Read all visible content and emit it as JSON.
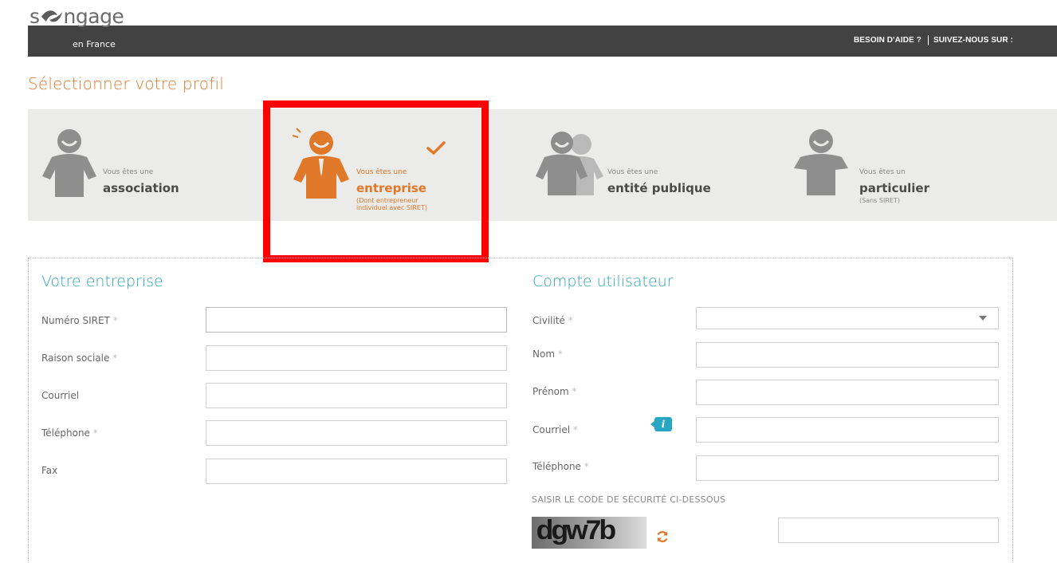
{
  "header": {
    "logo_text": "ngage",
    "logo_prefix": "s",
    "logo_subtitle": "en France",
    "help_link": "BESOIN D'AIDE ?",
    "follow_link": "SUIVEZ-NOUS SUR :"
  },
  "page_title": "Sélectionner votre profil",
  "profiles": [
    {
      "pre": "Vous êtes une",
      "main": "association",
      "note": ""
    },
    {
      "pre": "Vous êtes une",
      "main": "entreprise",
      "note_line1": "(Dont entrepreneur",
      "note_line2": "individuel avec SIRET)",
      "selected": true
    },
    {
      "pre": "Vous êtes une",
      "main": "entité publique",
      "note": ""
    },
    {
      "pre": "Vous êtes un",
      "main": "particulier",
      "note": "(Sans SIRET)"
    }
  ],
  "company_section": {
    "title": "Votre entreprise",
    "fields": [
      {
        "label": "Numéro SIRET",
        "required": "*",
        "value": ""
      },
      {
        "label": "Raison sociale",
        "required": "*",
        "value": ""
      },
      {
        "label": "Courriel",
        "required": "",
        "value": ""
      },
      {
        "label": "Téléphone",
        "required": "*",
        "value": ""
      },
      {
        "label": "Fax",
        "required": "",
        "value": ""
      }
    ]
  },
  "account_section": {
    "title": "Compte utilisateur",
    "fields": [
      {
        "label": "Civilité",
        "required": "*",
        "value": ""
      },
      {
        "label": "Nom",
        "required": "*",
        "value": ""
      },
      {
        "label": "Prénom",
        "required": "*",
        "value": ""
      },
      {
        "label": "Courriel",
        "required": "*",
        "value": ""
      },
      {
        "label": "Téléphone",
        "required": "*",
        "value": ""
      }
    ],
    "info_icon_glyph": "i",
    "captcha_label": "SAISIR LE CODE DE SÉCURITÉ CI-DESSOUS",
    "captcha_code": "dgw7b",
    "captcha_value": ""
  },
  "colors": {
    "accent_orange": "#e0782a",
    "accent_teal": "#2aa3b8",
    "header_bar": "#424242",
    "profile_band": "#ebebe9",
    "highlight": "#ff0000"
  },
  "icons": [
    "association-person-icon",
    "entreprise-person-icon",
    "checkmark-icon",
    "entite-publique-people-icon",
    "particulier-person-icon",
    "info-icon",
    "refresh-icon",
    "chevron-down-icon"
  ]
}
